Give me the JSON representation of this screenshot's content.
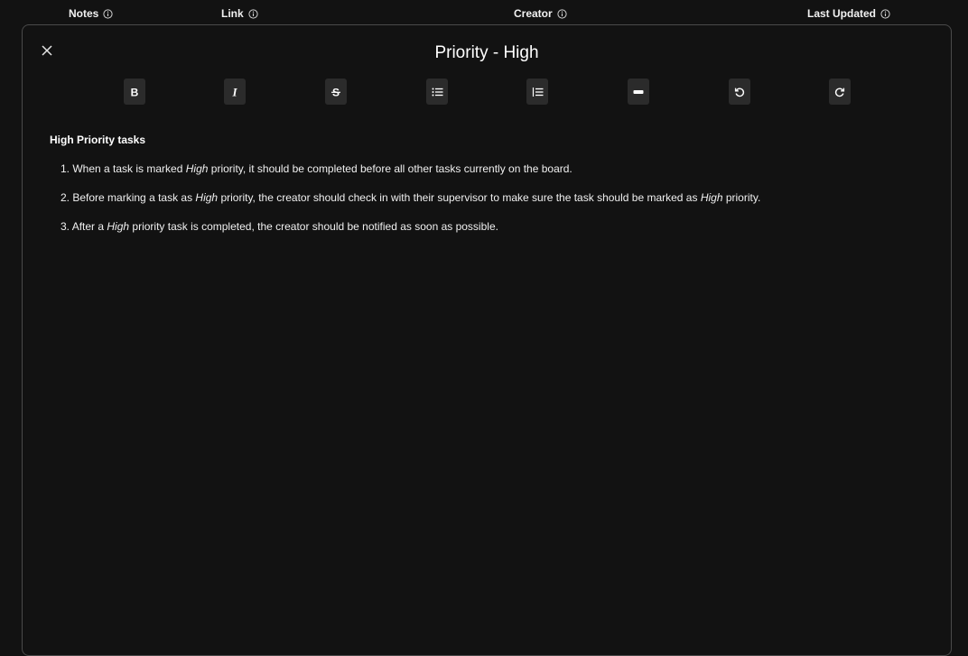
{
  "header": {
    "columns": [
      {
        "label": "Notes"
      },
      {
        "label": "Link"
      },
      {
        "label": "Creator"
      },
      {
        "label": "Last Updated"
      }
    ]
  },
  "modal": {
    "title": "Priority - High",
    "close_icon": "close-icon",
    "toolbar": [
      {
        "name": "bold",
        "icon": "bold-icon"
      },
      {
        "name": "italic",
        "icon": "italic-icon"
      },
      {
        "name": "strikethrough",
        "icon": "strikethrough-icon"
      },
      {
        "name": "bullet-list",
        "icon": "bullet-list-icon"
      },
      {
        "name": "numbered-list",
        "icon": "numbered-list-icon"
      },
      {
        "name": "horizontal-rule",
        "icon": "horizontal-rule-icon"
      },
      {
        "name": "undo",
        "icon": "undo-icon"
      },
      {
        "name": "redo",
        "icon": "redo-icon"
      }
    ],
    "content": {
      "heading": "High Priority tasks",
      "items": [
        {
          "number": "1.",
          "parts": [
            {
              "text": "When a task is marked ",
              "italic": false
            },
            {
              "text": "High",
              "italic": true
            },
            {
              "text": " priority, it should be completed before all other tasks currently on the board.",
              "italic": false
            }
          ]
        },
        {
          "number": "2.",
          "parts": [
            {
              "text": "Before marking a task as ",
              "italic": false
            },
            {
              "text": "High",
              "italic": true
            },
            {
              "text": " priority, the creator should check in with their supervisor to make sure the task should be marked as ",
              "italic": false
            },
            {
              "text": "High",
              "italic": true
            },
            {
              "text": " priority.",
              "italic": false
            }
          ]
        },
        {
          "number": "3.",
          "parts": [
            {
              "text": "After a ",
              "italic": false
            },
            {
              "text": "High",
              "italic": true
            },
            {
              "text": " priority task is completed, the creator should be notified as soon as possible.",
              "italic": false
            }
          ]
        }
      ]
    }
  },
  "colors": {
    "background": "#121212",
    "button_bg": "#2b2b2b",
    "border": "#4a4a4a",
    "text": "#ffffff"
  }
}
